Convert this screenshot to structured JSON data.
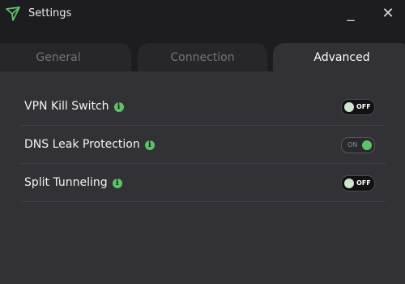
{
  "window": {
    "title": "Settings",
    "minimize_glyph": "_",
    "close_glyph": "✕"
  },
  "tabs": [
    {
      "label": "General",
      "active": false
    },
    {
      "label": "Connection",
      "active": false
    },
    {
      "label": "Advanced",
      "active": true
    }
  ],
  "settings": [
    {
      "label": "VPN Kill Switch",
      "toggle_text": "OFF",
      "state": "off"
    },
    {
      "label": "DNS Leak Protection",
      "toggle_text": "ON",
      "state": "on"
    },
    {
      "label": "Split Tunneling",
      "toggle_text": "OFF",
      "state": "off"
    }
  ],
  "info_glyph": "i",
  "colors": {
    "accent": "#5ec26a",
    "background": "#313136",
    "titlebar": "#1d1d21"
  }
}
